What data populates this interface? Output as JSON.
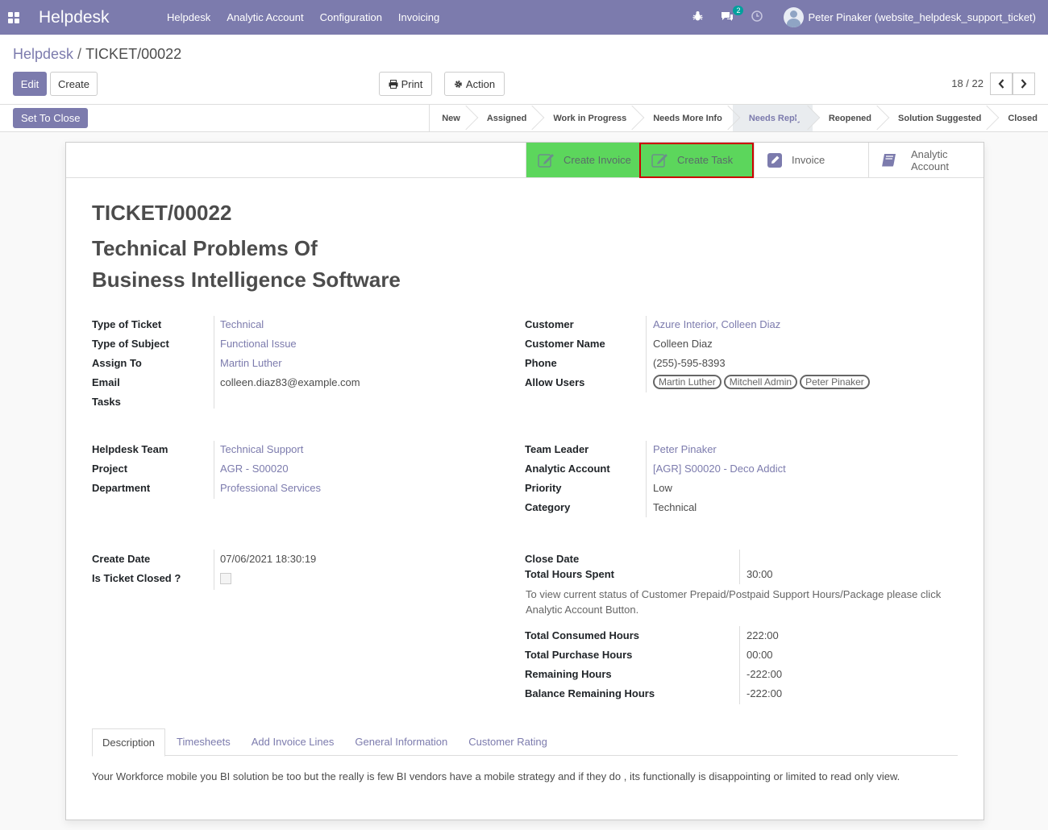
{
  "navbar": {
    "brand": "Helpdesk",
    "menu": [
      "Helpdesk",
      "Analytic Account",
      "Configuration",
      "Invoicing"
    ],
    "chat_badge": "2",
    "user": "Peter Pinaker (website_helpdesk_support_ticket)"
  },
  "breadcrumb": {
    "parent": "Helpdesk",
    "separator": "/",
    "current": "TICKET/00022"
  },
  "buttons": {
    "edit": "Edit",
    "create": "Create",
    "print": "Print",
    "action": "Action",
    "set_to_close": "Set To Close"
  },
  "pager": {
    "value": "18 / 22"
  },
  "stages": [
    "New",
    "Assigned",
    "Work in Progress",
    "Needs More Info",
    "Needs Reply",
    "Reopened",
    "Solution Suggested",
    "Closed"
  ],
  "active_stage": "Needs Reply",
  "smart_buttons": {
    "create_invoice": "Create Invoice",
    "create_task": "Create Task",
    "invoice": "Invoice",
    "analytic_1": "Analytic",
    "analytic_2": "Account"
  },
  "ticket": {
    "number": "TICKET/00022",
    "title_line1": "Technical Problems Of",
    "title_line2": "Business Intelligence Software"
  },
  "left_group1": {
    "labels": [
      "Type of Ticket",
      "Type of Subject",
      "Assign To",
      "Email",
      "Tasks"
    ],
    "values": [
      "Technical",
      "Functional Issue",
      "Martin Luther",
      "colleen.diaz83@example.com",
      ""
    ]
  },
  "right_group1": {
    "labels": [
      "Customer",
      "Customer Name",
      "Phone",
      "Allow Users"
    ],
    "values": [
      "Azure Interior, Colleen Diaz",
      "Colleen Diaz",
      "(255)-595-8393"
    ],
    "allow_users": [
      "Martin Luther",
      "Mitchell Admin",
      "Peter Pinaker"
    ]
  },
  "left_group2": {
    "labels": [
      "Helpdesk Team",
      "Project",
      "Department"
    ],
    "values": [
      "Technical Support",
      "AGR - S00020",
      "Professional Services"
    ]
  },
  "right_group2": {
    "labels": [
      "Team Leader",
      "Analytic Account",
      "Priority",
      "Category"
    ],
    "values": [
      "Peter Pinaker",
      "[AGR] S00020 - Deco Addict",
      "Low",
      "Technical"
    ]
  },
  "left_group3": {
    "labels": [
      "Create Date",
      "Is Ticket Closed ?"
    ],
    "values": [
      "07/06/2021 18:30:19"
    ]
  },
  "right_group3": {
    "labels": [
      "Close Date",
      "Total Hours Spent"
    ],
    "values": [
      "",
      "30:00"
    ],
    "help": "To view current status of Customer Prepaid/Postpaid Support Hours/Package please click Analytic Account Button.",
    "hour_labels": [
      "Total Consumed Hours",
      "Total Purchase Hours",
      "Remaining Hours",
      "Balance Remaining Hours"
    ],
    "hour_values": [
      "222:00",
      "00:00",
      "-222:00",
      "-222:00"
    ]
  },
  "tabs": [
    "Description",
    "Timesheets",
    "Add Invoice Lines",
    "General Information",
    "Customer Rating"
  ],
  "description": "Your Workforce mobile  you BI solution be too but the really is few BI vendors have a mobile strategy and if they do , its functionally is disappointing or limited to read only view.",
  "colors": {
    "primary": "#7c7bad",
    "green_button": "#5cd65c",
    "highlight_border": "#cc0000"
  }
}
